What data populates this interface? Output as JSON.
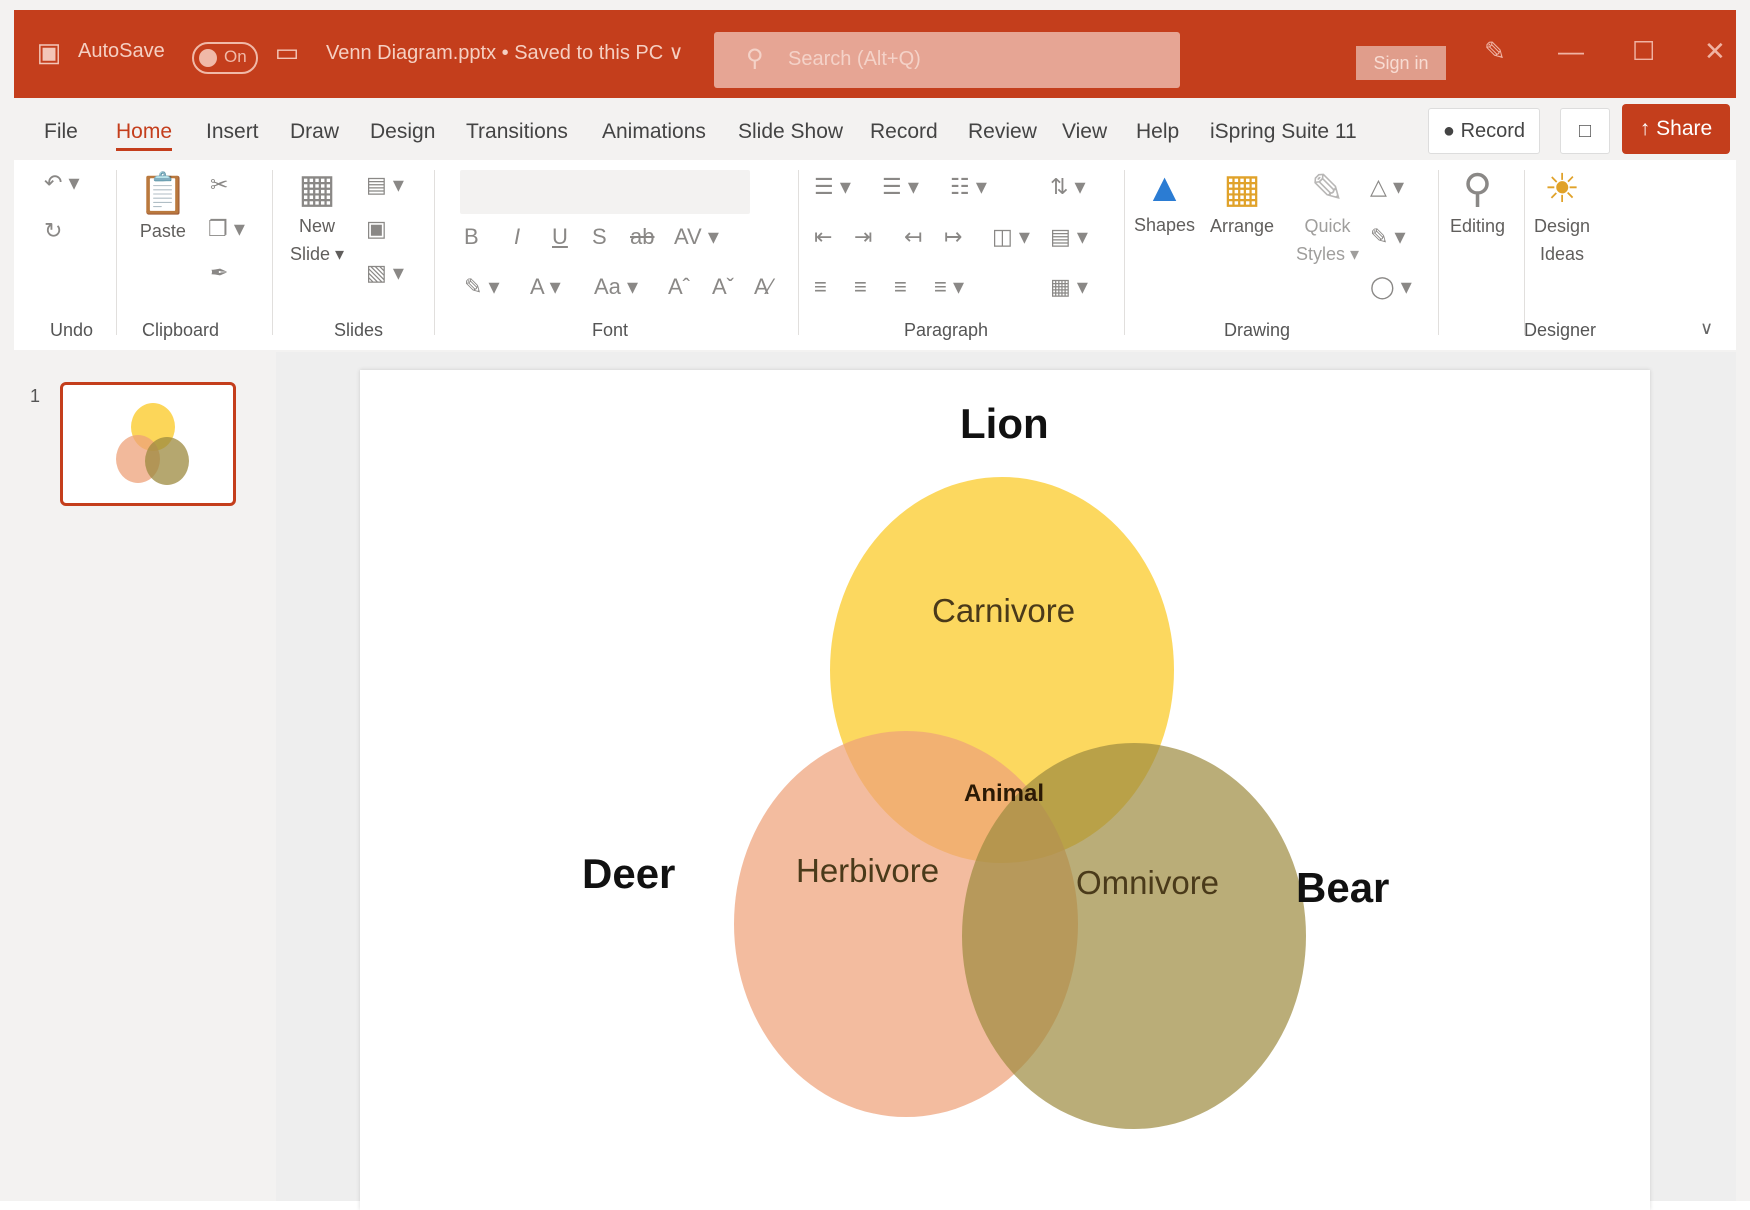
{
  "titlebar": {
    "autosave_label": "AutoSave",
    "autosave_state": "On",
    "doc_title": "Venn Diagram.pptx • Saved to this PC ∨",
    "search_placeholder": "Search (Alt+Q)",
    "sign_in": "Sign in"
  },
  "tabs": [
    "File",
    "Home",
    "Insert",
    "Draw",
    "Design",
    "Transitions",
    "Animations",
    "Slide Show",
    "Record",
    "Review",
    "View",
    "Help",
    "iSpring Suite 11"
  ],
  "active_tab": "Home",
  "actions": {
    "record": "Record",
    "share": "Share"
  },
  "ribbon": {
    "groups": [
      "Undo",
      "Clipboard",
      "Slides",
      "Font",
      "Paragraph",
      "Drawing",
      "Designer"
    ],
    "paste": "Paste",
    "new_slide_1": "New",
    "new_slide_2": "Slide ▾",
    "shapes": "Shapes",
    "arrange": "Arrange",
    "quick_styles_1": "Quick",
    "quick_styles_2": "Styles ▾",
    "editing": "Editing",
    "design_ideas_1": "Design",
    "design_ideas_2": "Ideas"
  },
  "thumbnail": {
    "number": "1"
  },
  "slide": {
    "labels": {
      "top": "Lion",
      "left": "Deer",
      "right": "Bear"
    },
    "circles": {
      "top": "Carnivore",
      "left": "Herbivore",
      "right": "Omnivore",
      "center": "Animal"
    },
    "colors": {
      "top": "#fbcf3c",
      "left": "#eea27a",
      "right": "#9c8a3f"
    }
  }
}
